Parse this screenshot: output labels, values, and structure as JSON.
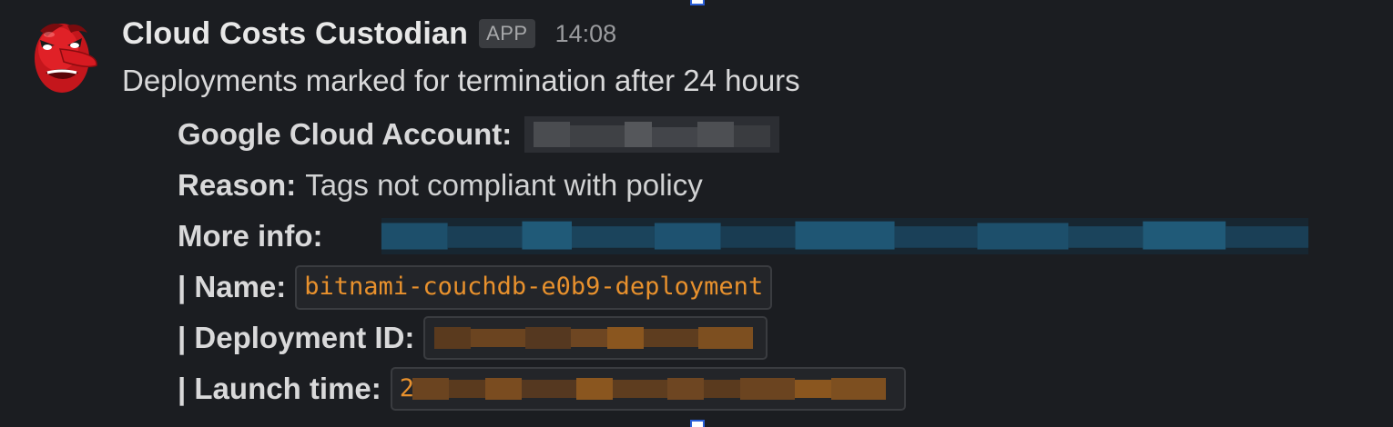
{
  "message": {
    "sender": "Cloud Costs Custodian",
    "badge": "APP",
    "time": "14:08",
    "headline": "Deployments marked for termination after 24 hours",
    "fields": {
      "account_label": "Google Cloud Account:",
      "reason_label": "Reason:",
      "reason_value": "Tags not compliant with policy",
      "more_info_label": "More info:",
      "name_label": "| Name:",
      "name_value": "bitnami-couchdb-e0b9-deployment",
      "deployment_id_label": "| Deployment ID:",
      "launch_time_label": "| Launch time:",
      "launch_time_partial": "2"
    }
  },
  "icons": {
    "avatar": "tengu-mask-icon"
  },
  "colors": {
    "background": "#1b1d21",
    "code_text": "#e8912d",
    "link_blur": "#1d4f6b"
  }
}
